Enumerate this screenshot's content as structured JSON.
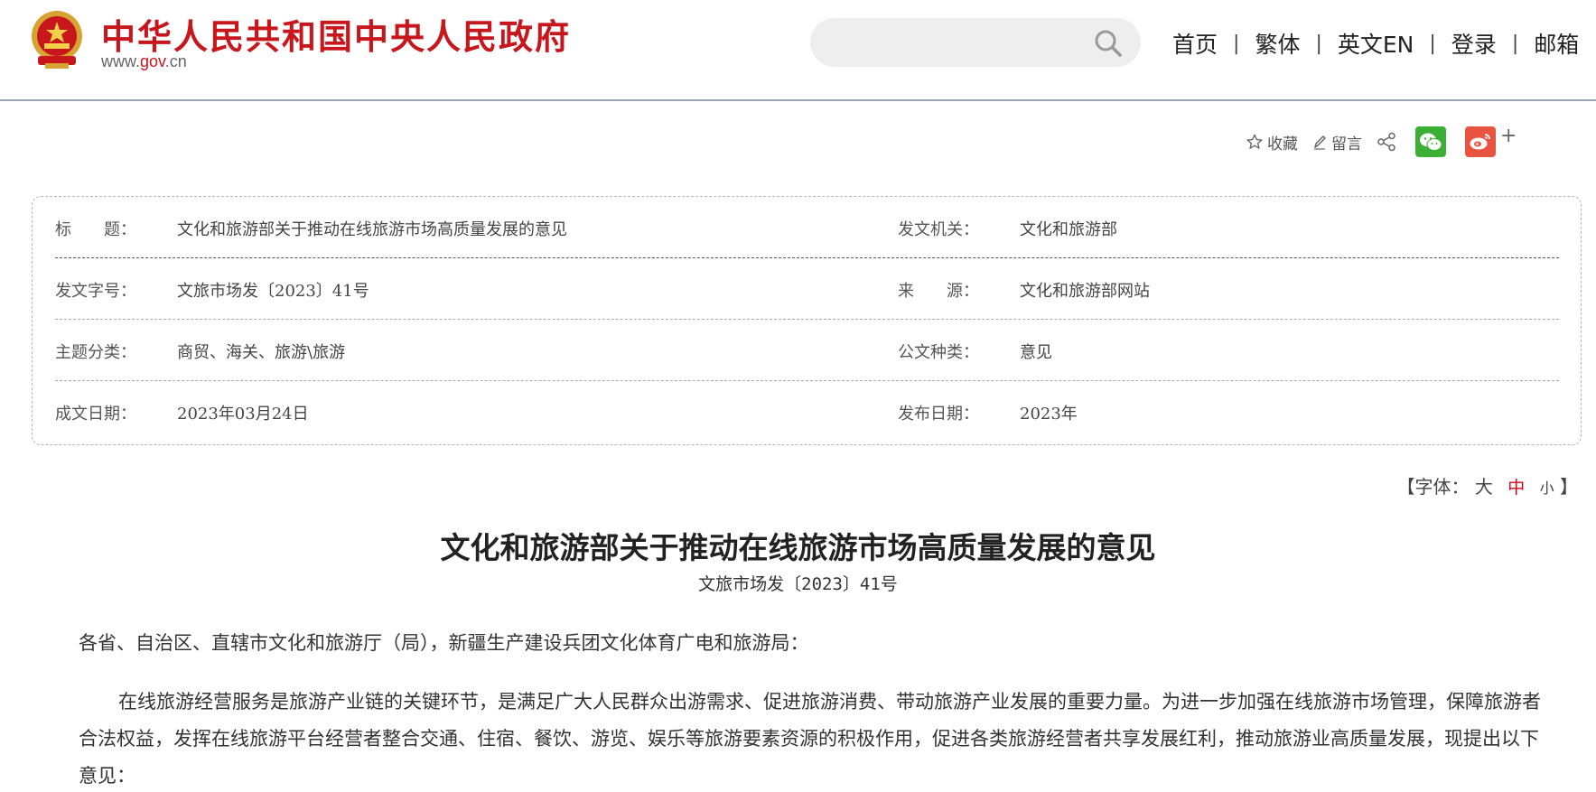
{
  "header": {
    "site_name": "中华人民共和国中央人民政府",
    "url_prefix": "www.",
    "url_gov": "gov",
    "url_suffix": ".cn",
    "search_placeholder": "",
    "nav": [
      "首页",
      "繁体",
      "英文EN",
      "登录",
      "邮箱"
    ],
    "separator": "|"
  },
  "toolbar": {
    "favorite_label": "收藏",
    "comment_label": "留言",
    "more_label": "+"
  },
  "info": {
    "title_label": "标　　题：",
    "title_value": "文化和旅游部关于推动在线旅游市场高质量发展的意见",
    "issuer_label": "发文机关：",
    "issuer_value": "文化和旅游部",
    "docno_label": "发文字号：",
    "docno_value": "文旅市场发〔2023〕41号",
    "source_label": "来　　源：",
    "source_value": "文化和旅游部网站",
    "topic_label": "主题分类：",
    "topic_value": "商贸、海关、旅游\\旅游",
    "doctype_label": "公文种类：",
    "doctype_value": "意见",
    "written_label": "成文日期：",
    "written_value": "2023年03月24日",
    "published_label": "发布日期：",
    "published_value": "2023年"
  },
  "fontsize": {
    "open": "【字体：",
    "large": "大",
    "medium": "中",
    "small": "小",
    "close": "】"
  },
  "article": {
    "title": "文化和旅游部关于推动在线旅游市场高质量发展的意见",
    "docno": "文旅市场发〔2023〕41号",
    "salutation": "各省、自治区、直辖市文化和旅游厅（局），新疆生产建设兵团文化体育广电和旅游局：",
    "paragraph": "在线旅游经营服务是旅游产业链的关键环节，是满足广大人民群众出游需求、促进旅游消费、带动旅游产业发展的重要力量。为进一步加强在线旅游市场管理，保障旅游者合法权益，发挥在线旅游平台经营者整合交通、住宿、餐饮、游览、娱乐等旅游要素资源的积极作用，促进各类旅游经营者共享发展红利，推动旅游业高质量发展，现提出以下意见："
  },
  "colors": {
    "brand_red": "#c8161d",
    "wechat_green": "#3cb034",
    "weibo_red": "#e8543f"
  }
}
